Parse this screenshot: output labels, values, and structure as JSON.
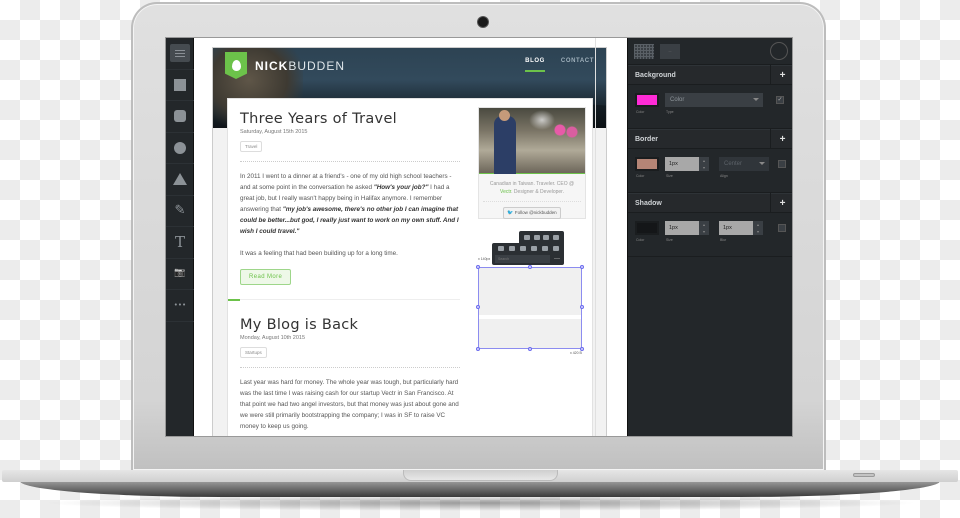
{
  "editor": {
    "tools": [
      {
        "name": "menu",
        "icon": "hamburger-icon"
      },
      {
        "name": "rectangle",
        "icon": "square-icon"
      },
      {
        "name": "rounded-rectangle",
        "icon": "rounded-square-icon"
      },
      {
        "name": "ellipse",
        "icon": "circle-icon"
      },
      {
        "name": "polygon",
        "icon": "triangle-icon"
      },
      {
        "name": "pen",
        "icon": "pen-icon",
        "glyph": "✎"
      },
      {
        "name": "text",
        "icon": "text-icon",
        "glyph": "T"
      },
      {
        "name": "image",
        "icon": "camera-icon",
        "glyph": "📷"
      },
      {
        "name": "more",
        "icon": "more-icon",
        "glyph": "•••"
      }
    ]
  },
  "site": {
    "logo": {
      "bold": "NICK",
      "light": "BUDDEN"
    },
    "nav": [
      {
        "label": "BLOG",
        "active": true
      },
      {
        "label": "CONTACT",
        "active": false
      }
    ],
    "posts": [
      {
        "title": "Three Years of Travel",
        "date": "Saturday, August 15th 2015",
        "tag": "Travel",
        "body_1_a": "In 2011 I went to a dinner at a friend's - one of my old high school teachers - and at some point in the conversation he asked ",
        "body_1_em1": "\"How's your job?\"",
        "body_1_b": " I had a great job, but I really wasn't happy being in Halifax anymore. I remember answering that ",
        "body_1_em2": "\"my job's awesome, there's no other job I can imagine that could be better...but god, I really just want to work on my own stuff. And I wish I could travel.\"",
        "body_2": "It was a feeling that had been building up for a long time.",
        "read_more": "Read More"
      },
      {
        "title": "My Blog is Back",
        "date": "Monday, August 10th 2015",
        "tag": "Startups",
        "body_1": "Last year was hard for money. The whole year was tough, but particularly hard was the last time I was raising cash for our startup Vectr in San Francisco. At that point we had two angel investors, but that money was just about gone and we were still primarily bootstrapping the company; I was in SF to raise VC money to keep us going."
      }
    ],
    "profile": {
      "bio_a": "Canadian in Taiwan. Traveler. CEO @ ",
      "bio_link": "Vectr",
      "bio_b": ". Designer & Developer.",
      "follow_label": "Follow @nickbudden"
    },
    "selection": {
      "size_label_top": "x 140px",
      "size_label_bottom": "x 420 B",
      "search_placeholder": "Search"
    }
  },
  "inspector": {
    "tabs": [
      "grid",
      "layers"
    ],
    "background": {
      "title": "Background",
      "color": "#ff2bd6",
      "color_label": "Color",
      "type_value": "Color",
      "type_label": "Type",
      "enabled": true
    },
    "border": {
      "title": "Border",
      "color": "#b58576",
      "color_label": "Color",
      "size_value": "1px",
      "size_label": "Size",
      "align_value": "Center",
      "align_label": "Align",
      "enabled": false
    },
    "shadow": {
      "title": "Shadow",
      "color": "#141618",
      "color_label": "Color",
      "size_value": "1px",
      "size_label": "Size",
      "blur_value": "1px",
      "blur_label": "Blur",
      "enabled": false
    }
  }
}
